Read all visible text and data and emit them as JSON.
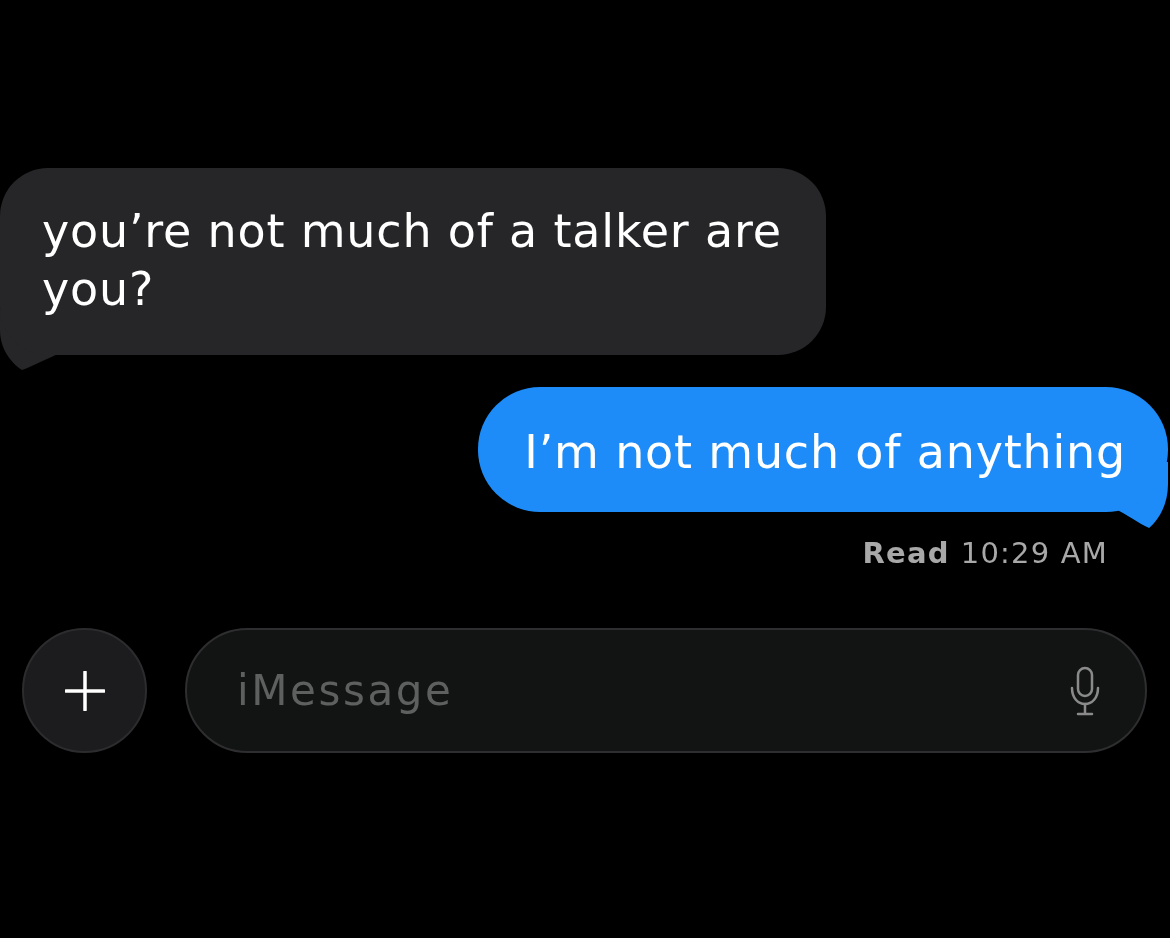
{
  "messages": [
    {
      "kind": "received",
      "text": "you’re not much of a talker are you?"
    },
    {
      "kind": "sent",
      "text": "I’m not much of anything"
    }
  ],
  "receipt": {
    "status": "Read",
    "time": "10:29 AM"
  },
  "composer": {
    "placeholder": "iMessage"
  }
}
